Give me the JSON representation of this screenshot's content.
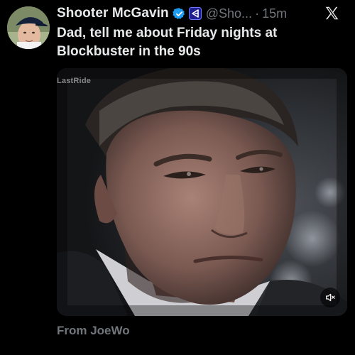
{
  "post": {
    "display_name": "Shooter McGavin",
    "handle": "@Sho...",
    "dot": "·",
    "timestamp": "15m",
    "text": "Dad, tell me about Friday nights at Blockbuster in the 90s",
    "verified_icon": "verified-badge-icon",
    "affiliation_icon": "affiliation-badge-icon"
  },
  "media": {
    "watermark": "LastRide",
    "mute_icon": "speaker-muted-icon"
  },
  "attribution": "From JoeWo",
  "colors": {
    "background": "#000000",
    "primary_text": "#e7e9ea",
    "secondary_text": "#71767b",
    "verified_blue": "#1d9bf0",
    "affiliation_blue": "#3a2fd8"
  }
}
